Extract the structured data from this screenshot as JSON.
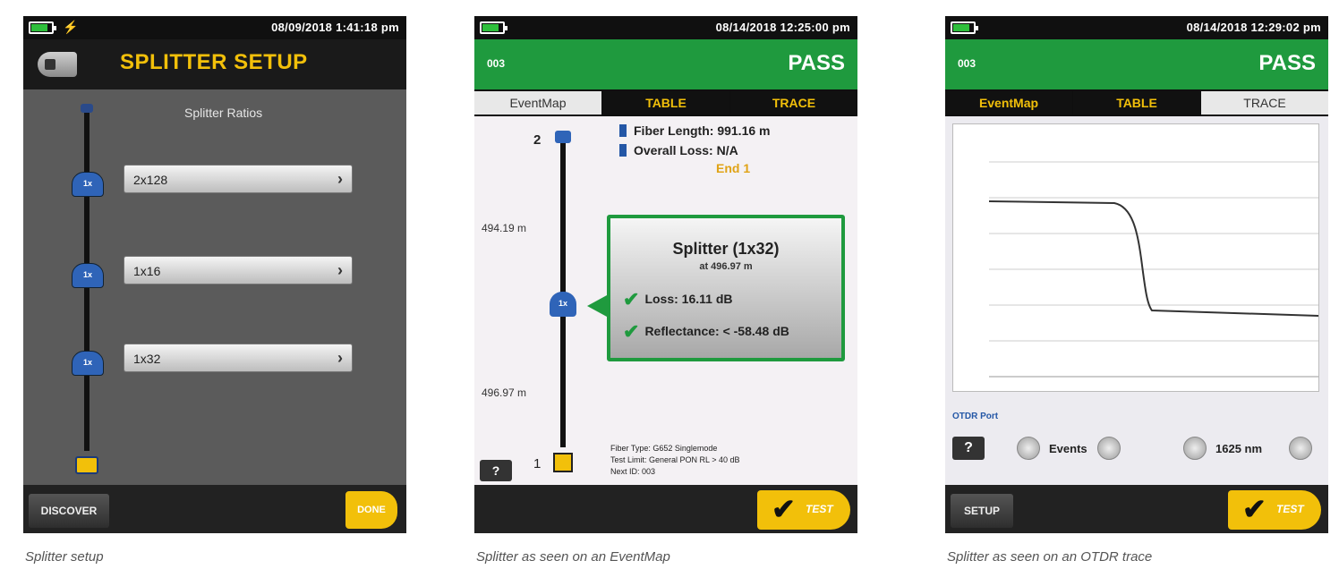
{
  "screens": {
    "setup": {
      "datetime": "08/09/2018 1:41:18 pm",
      "title": "SPLITTER SETUP",
      "ratios_label": "Splitter Ratios",
      "ratios": [
        "2x128",
        "1x16",
        "1x32"
      ],
      "discover": "DISCOVER",
      "done": "DONE",
      "caption": "Splitter setup"
    },
    "eventmap": {
      "datetime": "08/14/2018 12:25:00 pm",
      "id": "003",
      "status": "PASS",
      "tabs": [
        "EventMap",
        "TABLE",
        "TRACE"
      ],
      "fiber_length": "Fiber Length:  991.16 m",
      "overall_loss": "Overall Loss:   N/A",
      "end_label": "End 1",
      "top_number": "2",
      "bottom_number": "1",
      "distance_top": "494.19 m",
      "distance_bottom": "496.97 m",
      "callout_title": "Splitter (1x32)",
      "callout_sub": "at 496.97 m",
      "loss": "Loss: 16.11 dB",
      "reflectance": "Reflectance: < -58.48 dB",
      "fiber_type": "Fiber Type: G652 Singlemode",
      "test_limit": "Test Limit: General PON RL > 40 dB",
      "next_id": "Next ID: 003",
      "help": "?",
      "test": "TEST",
      "caption": "Splitter as seen on an EventMap"
    },
    "trace": {
      "datetime": "08/14/2018 12:29:02 pm",
      "id": "003",
      "status": "PASS",
      "tabs": [
        "EventMap",
        "TABLE",
        "TRACE"
      ],
      "otdr_port": "OTDR Port",
      "events_label": "Events",
      "wavelength": "1625 nm",
      "setup": "SETUP",
      "help": "?",
      "test": "TEST",
      "caption": "Splitter as seen on an OTDR trace"
    }
  },
  "colors": {
    "pass_green": "#1f9a3e",
    "accent_yellow": "#f2c00a",
    "link_blue": "#2457a6"
  }
}
